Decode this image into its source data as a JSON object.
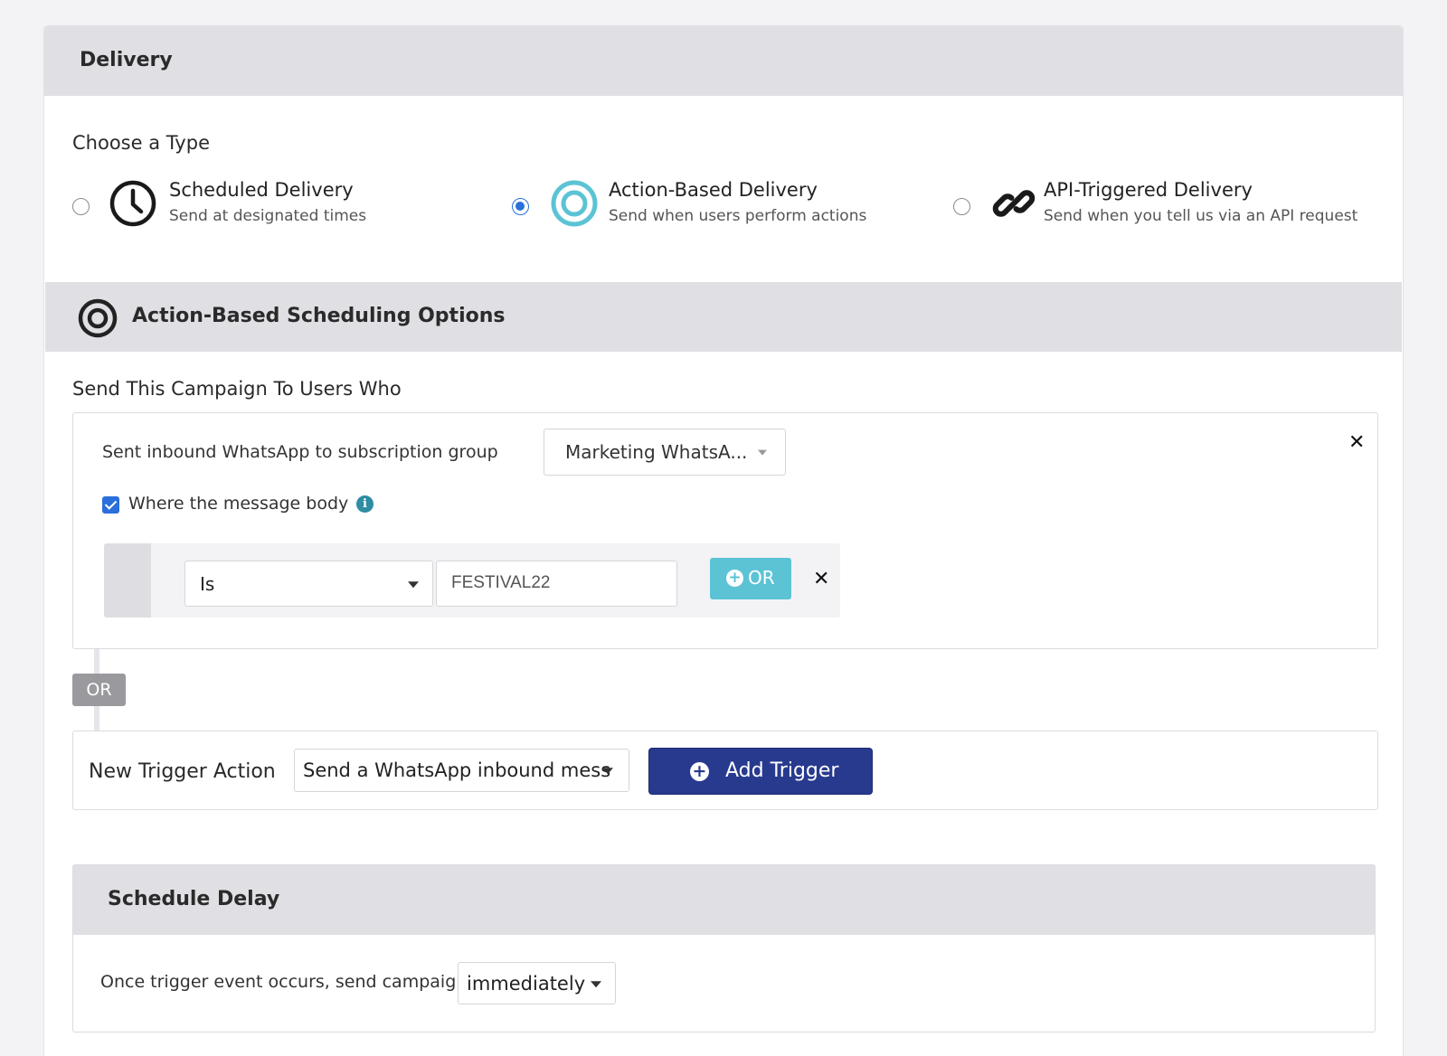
{
  "delivery": {
    "title": "Delivery",
    "choose_label": "Choose a Type",
    "types": [
      {
        "title": "Scheduled Delivery",
        "desc": "Send at designated times",
        "icon": "clock-icon",
        "selected": false
      },
      {
        "title": "Action-Based Delivery",
        "desc": "Send when users perform actions",
        "icon": "target-icon",
        "selected": true
      },
      {
        "title": "API-Triggered Delivery",
        "desc": "Send when you tell us via an API request",
        "icon": "link-icon",
        "selected": false
      }
    ]
  },
  "action_section": {
    "title": "Action-Based Scheduling Options",
    "send_label": "Send This Campaign To Users Who",
    "trigger": {
      "text": "Sent inbound WhatsApp to subscription group",
      "group_select": "Marketing WhatsA...",
      "checkbox_label": "Where the message body",
      "checkbox_checked": true,
      "filter": {
        "operator": "Is",
        "value": "FESTIVAL22",
        "or_button": "OR"
      }
    },
    "or_badge": "OR",
    "new_trigger": {
      "label": "New Trigger Action",
      "select": "Send a WhatsApp inbound messa",
      "add_button": "Add Trigger"
    }
  },
  "schedule_delay": {
    "title": "Schedule Delay",
    "text": "Once trigger event occurs, send campaign",
    "select": "immediately"
  },
  "colors": {
    "accent_blue": "#2a6fdb",
    "target_teal": "#5cc3d5",
    "add_button": "#283a8e",
    "header_gray": "#e0e0e4"
  }
}
